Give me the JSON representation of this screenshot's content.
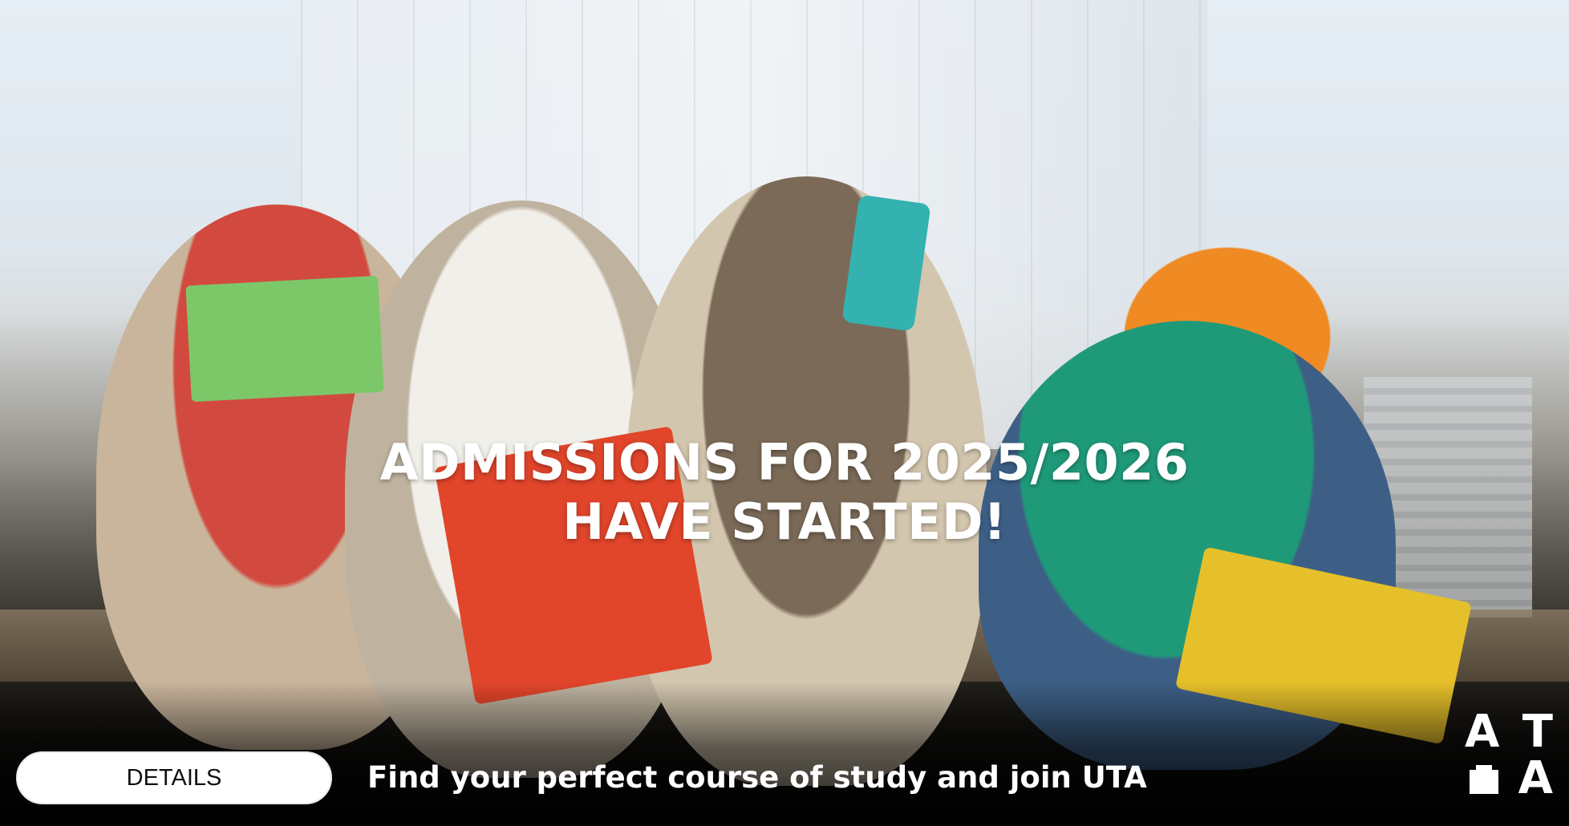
{
  "banner": {
    "headline_line1": "ADMISSIONS FOR 2025/2026",
    "headline_line2": "HAVE STARTED!",
    "details_label": "DETAILS",
    "tagline": "Find your perfect course of study and join UTA",
    "logo_text": "ATA",
    "logo_letters": [
      "A",
      "T",
      "A"
    ],
    "logo_icon": "bear-icon"
  },
  "colors": {
    "text": "#ffffff",
    "button_bg": "#ffffff",
    "button_text": "#111111"
  }
}
